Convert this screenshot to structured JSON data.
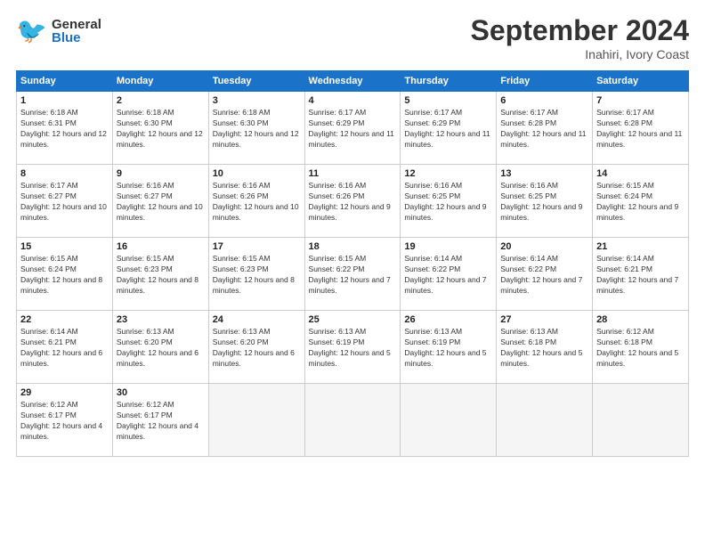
{
  "header": {
    "logo_general": "General",
    "logo_blue": "Blue",
    "month_title": "September 2024",
    "subtitle": "Inahiri, Ivory Coast"
  },
  "days_of_week": [
    "Sunday",
    "Monday",
    "Tuesday",
    "Wednesday",
    "Thursday",
    "Friday",
    "Saturday"
  ],
  "weeks": [
    [
      {
        "day": "1",
        "sunrise": "6:18 AM",
        "sunset": "6:31 PM",
        "daylight": "12 hours and 12 minutes."
      },
      {
        "day": "2",
        "sunrise": "6:18 AM",
        "sunset": "6:30 PM",
        "daylight": "12 hours and 12 minutes."
      },
      {
        "day": "3",
        "sunrise": "6:18 AM",
        "sunset": "6:30 PM",
        "daylight": "12 hours and 12 minutes."
      },
      {
        "day": "4",
        "sunrise": "6:17 AM",
        "sunset": "6:29 PM",
        "daylight": "12 hours and 11 minutes."
      },
      {
        "day": "5",
        "sunrise": "6:17 AM",
        "sunset": "6:29 PM",
        "daylight": "12 hours and 11 minutes."
      },
      {
        "day": "6",
        "sunrise": "6:17 AM",
        "sunset": "6:28 PM",
        "daylight": "12 hours and 11 minutes."
      },
      {
        "day": "7",
        "sunrise": "6:17 AM",
        "sunset": "6:28 PM",
        "daylight": "12 hours and 11 minutes."
      }
    ],
    [
      {
        "day": "8",
        "sunrise": "6:17 AM",
        "sunset": "6:27 PM",
        "daylight": "12 hours and 10 minutes."
      },
      {
        "day": "9",
        "sunrise": "6:16 AM",
        "sunset": "6:27 PM",
        "daylight": "12 hours and 10 minutes."
      },
      {
        "day": "10",
        "sunrise": "6:16 AM",
        "sunset": "6:26 PM",
        "daylight": "12 hours and 10 minutes."
      },
      {
        "day": "11",
        "sunrise": "6:16 AM",
        "sunset": "6:26 PM",
        "daylight": "12 hours and 9 minutes."
      },
      {
        "day": "12",
        "sunrise": "6:16 AM",
        "sunset": "6:25 PM",
        "daylight": "12 hours and 9 minutes."
      },
      {
        "day": "13",
        "sunrise": "6:16 AM",
        "sunset": "6:25 PM",
        "daylight": "12 hours and 9 minutes."
      },
      {
        "day": "14",
        "sunrise": "6:15 AM",
        "sunset": "6:24 PM",
        "daylight": "12 hours and 9 minutes."
      }
    ],
    [
      {
        "day": "15",
        "sunrise": "6:15 AM",
        "sunset": "6:24 PM",
        "daylight": "12 hours and 8 minutes."
      },
      {
        "day": "16",
        "sunrise": "6:15 AM",
        "sunset": "6:23 PM",
        "daylight": "12 hours and 8 minutes."
      },
      {
        "day": "17",
        "sunrise": "6:15 AM",
        "sunset": "6:23 PM",
        "daylight": "12 hours and 8 minutes."
      },
      {
        "day": "18",
        "sunrise": "6:15 AM",
        "sunset": "6:22 PM",
        "daylight": "12 hours and 7 minutes."
      },
      {
        "day": "19",
        "sunrise": "6:14 AM",
        "sunset": "6:22 PM",
        "daylight": "12 hours and 7 minutes."
      },
      {
        "day": "20",
        "sunrise": "6:14 AM",
        "sunset": "6:22 PM",
        "daylight": "12 hours and 7 minutes."
      },
      {
        "day": "21",
        "sunrise": "6:14 AM",
        "sunset": "6:21 PM",
        "daylight": "12 hours and 7 minutes."
      }
    ],
    [
      {
        "day": "22",
        "sunrise": "6:14 AM",
        "sunset": "6:21 PM",
        "daylight": "12 hours and 6 minutes."
      },
      {
        "day": "23",
        "sunrise": "6:13 AM",
        "sunset": "6:20 PM",
        "daylight": "12 hours and 6 minutes."
      },
      {
        "day": "24",
        "sunrise": "6:13 AM",
        "sunset": "6:20 PM",
        "daylight": "12 hours and 6 minutes."
      },
      {
        "day": "25",
        "sunrise": "6:13 AM",
        "sunset": "6:19 PM",
        "daylight": "12 hours and 5 minutes."
      },
      {
        "day": "26",
        "sunrise": "6:13 AM",
        "sunset": "6:19 PM",
        "daylight": "12 hours and 5 minutes."
      },
      {
        "day": "27",
        "sunrise": "6:13 AM",
        "sunset": "6:18 PM",
        "daylight": "12 hours and 5 minutes."
      },
      {
        "day": "28",
        "sunrise": "6:12 AM",
        "sunset": "6:18 PM",
        "daylight": "12 hours and 5 minutes."
      }
    ],
    [
      {
        "day": "29",
        "sunrise": "6:12 AM",
        "sunset": "6:17 PM",
        "daylight": "12 hours and 4 minutes."
      },
      {
        "day": "30",
        "sunrise": "6:12 AM",
        "sunset": "6:17 PM",
        "daylight": "12 hours and 4 minutes."
      },
      null,
      null,
      null,
      null,
      null
    ]
  ]
}
